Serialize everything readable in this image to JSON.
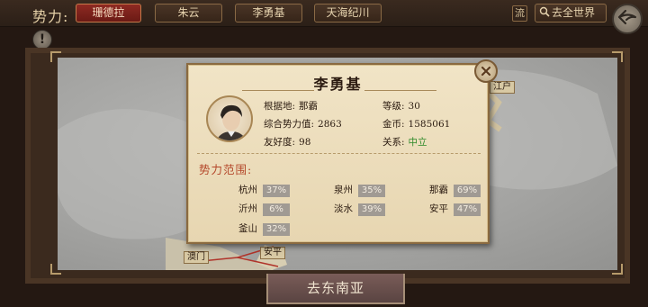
{
  "topbar": {
    "title": "势力:",
    "factions": [
      "珊德拉",
      "朱云",
      "李勇基",
      "天海纪川"
    ],
    "active_faction": "珊德拉",
    "flow_label": "流",
    "world_label": "去全世界",
    "alert_symbol": "!"
  },
  "map": {
    "ports": [
      "澳门",
      "安平"
    ],
    "edge_labels": [
      "江户"
    ]
  },
  "popup": {
    "name": "李勇基",
    "info": {
      "base_label": "根据地:",
      "base_value": "那霸",
      "level_label": "等级:",
      "level_value": "30",
      "power_label": "综合势力值:",
      "power_value": "2863",
      "gold_label": "金币:",
      "gold_value": "1585061",
      "friend_label": "友好度:",
      "friend_value": "98",
      "relation_label": "关系:",
      "relation_value": "中立"
    },
    "section_title": "势力范围:",
    "regions": [
      {
        "name": "杭州",
        "pct": "37%"
      },
      {
        "name": "泉州",
        "pct": "35%"
      },
      {
        "name": "那霸",
        "pct": "69%"
      },
      {
        "name": "沂州",
        "pct": "6%"
      },
      {
        "name": "淡水",
        "pct": "39%"
      },
      {
        "name": "安平",
        "pct": "47%"
      },
      {
        "name": "釜山",
        "pct": "32%"
      }
    ]
  },
  "bottom_tab": {
    "label": "去东南亚"
  },
  "colors": {
    "accent_red": "#8f2a22",
    "relation_green": "#2e8a2a",
    "section_red": "#b4472a"
  }
}
